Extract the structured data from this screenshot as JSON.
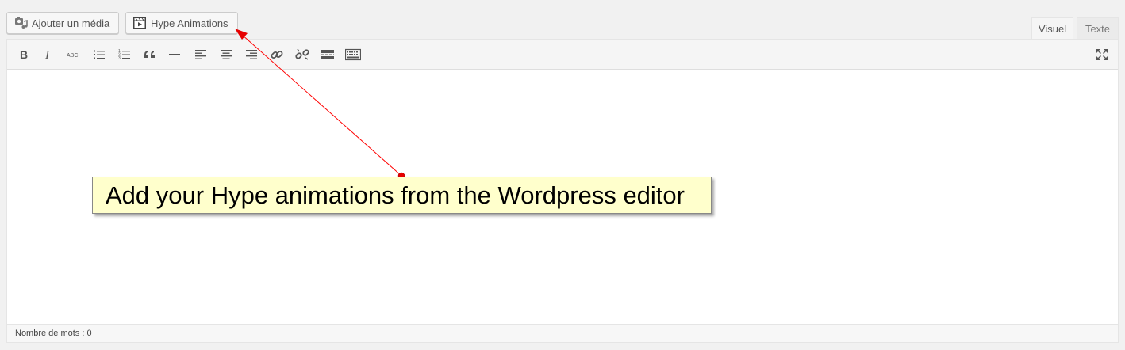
{
  "media_buttons": {
    "add_media_label": "Ajouter un média",
    "hype_label": "Hype Animations"
  },
  "tabs": {
    "visual_label": "Visuel",
    "text_label": "Texte"
  },
  "toolbar": {
    "strike_abbr": "ABC",
    "buttons": [
      "bold-icon",
      "italic-icon",
      "strikethrough-icon",
      "bullet-list-icon",
      "numbered-list-icon",
      "blockquote-icon",
      "horizontal-line-icon",
      "align-left-icon",
      "align-center-icon",
      "align-right-icon",
      "link-icon",
      "unlink-icon",
      "read-more-icon",
      "toolbar-toggle-icon",
      "fullscreen-icon"
    ]
  },
  "statusbar": {
    "word_count_text": "Nombre de mots : 0"
  },
  "annotation": {
    "text": "Add your Hype animations from the Wordpress editor",
    "color": "#ffffcc",
    "arrow_color": "#ff0000"
  }
}
